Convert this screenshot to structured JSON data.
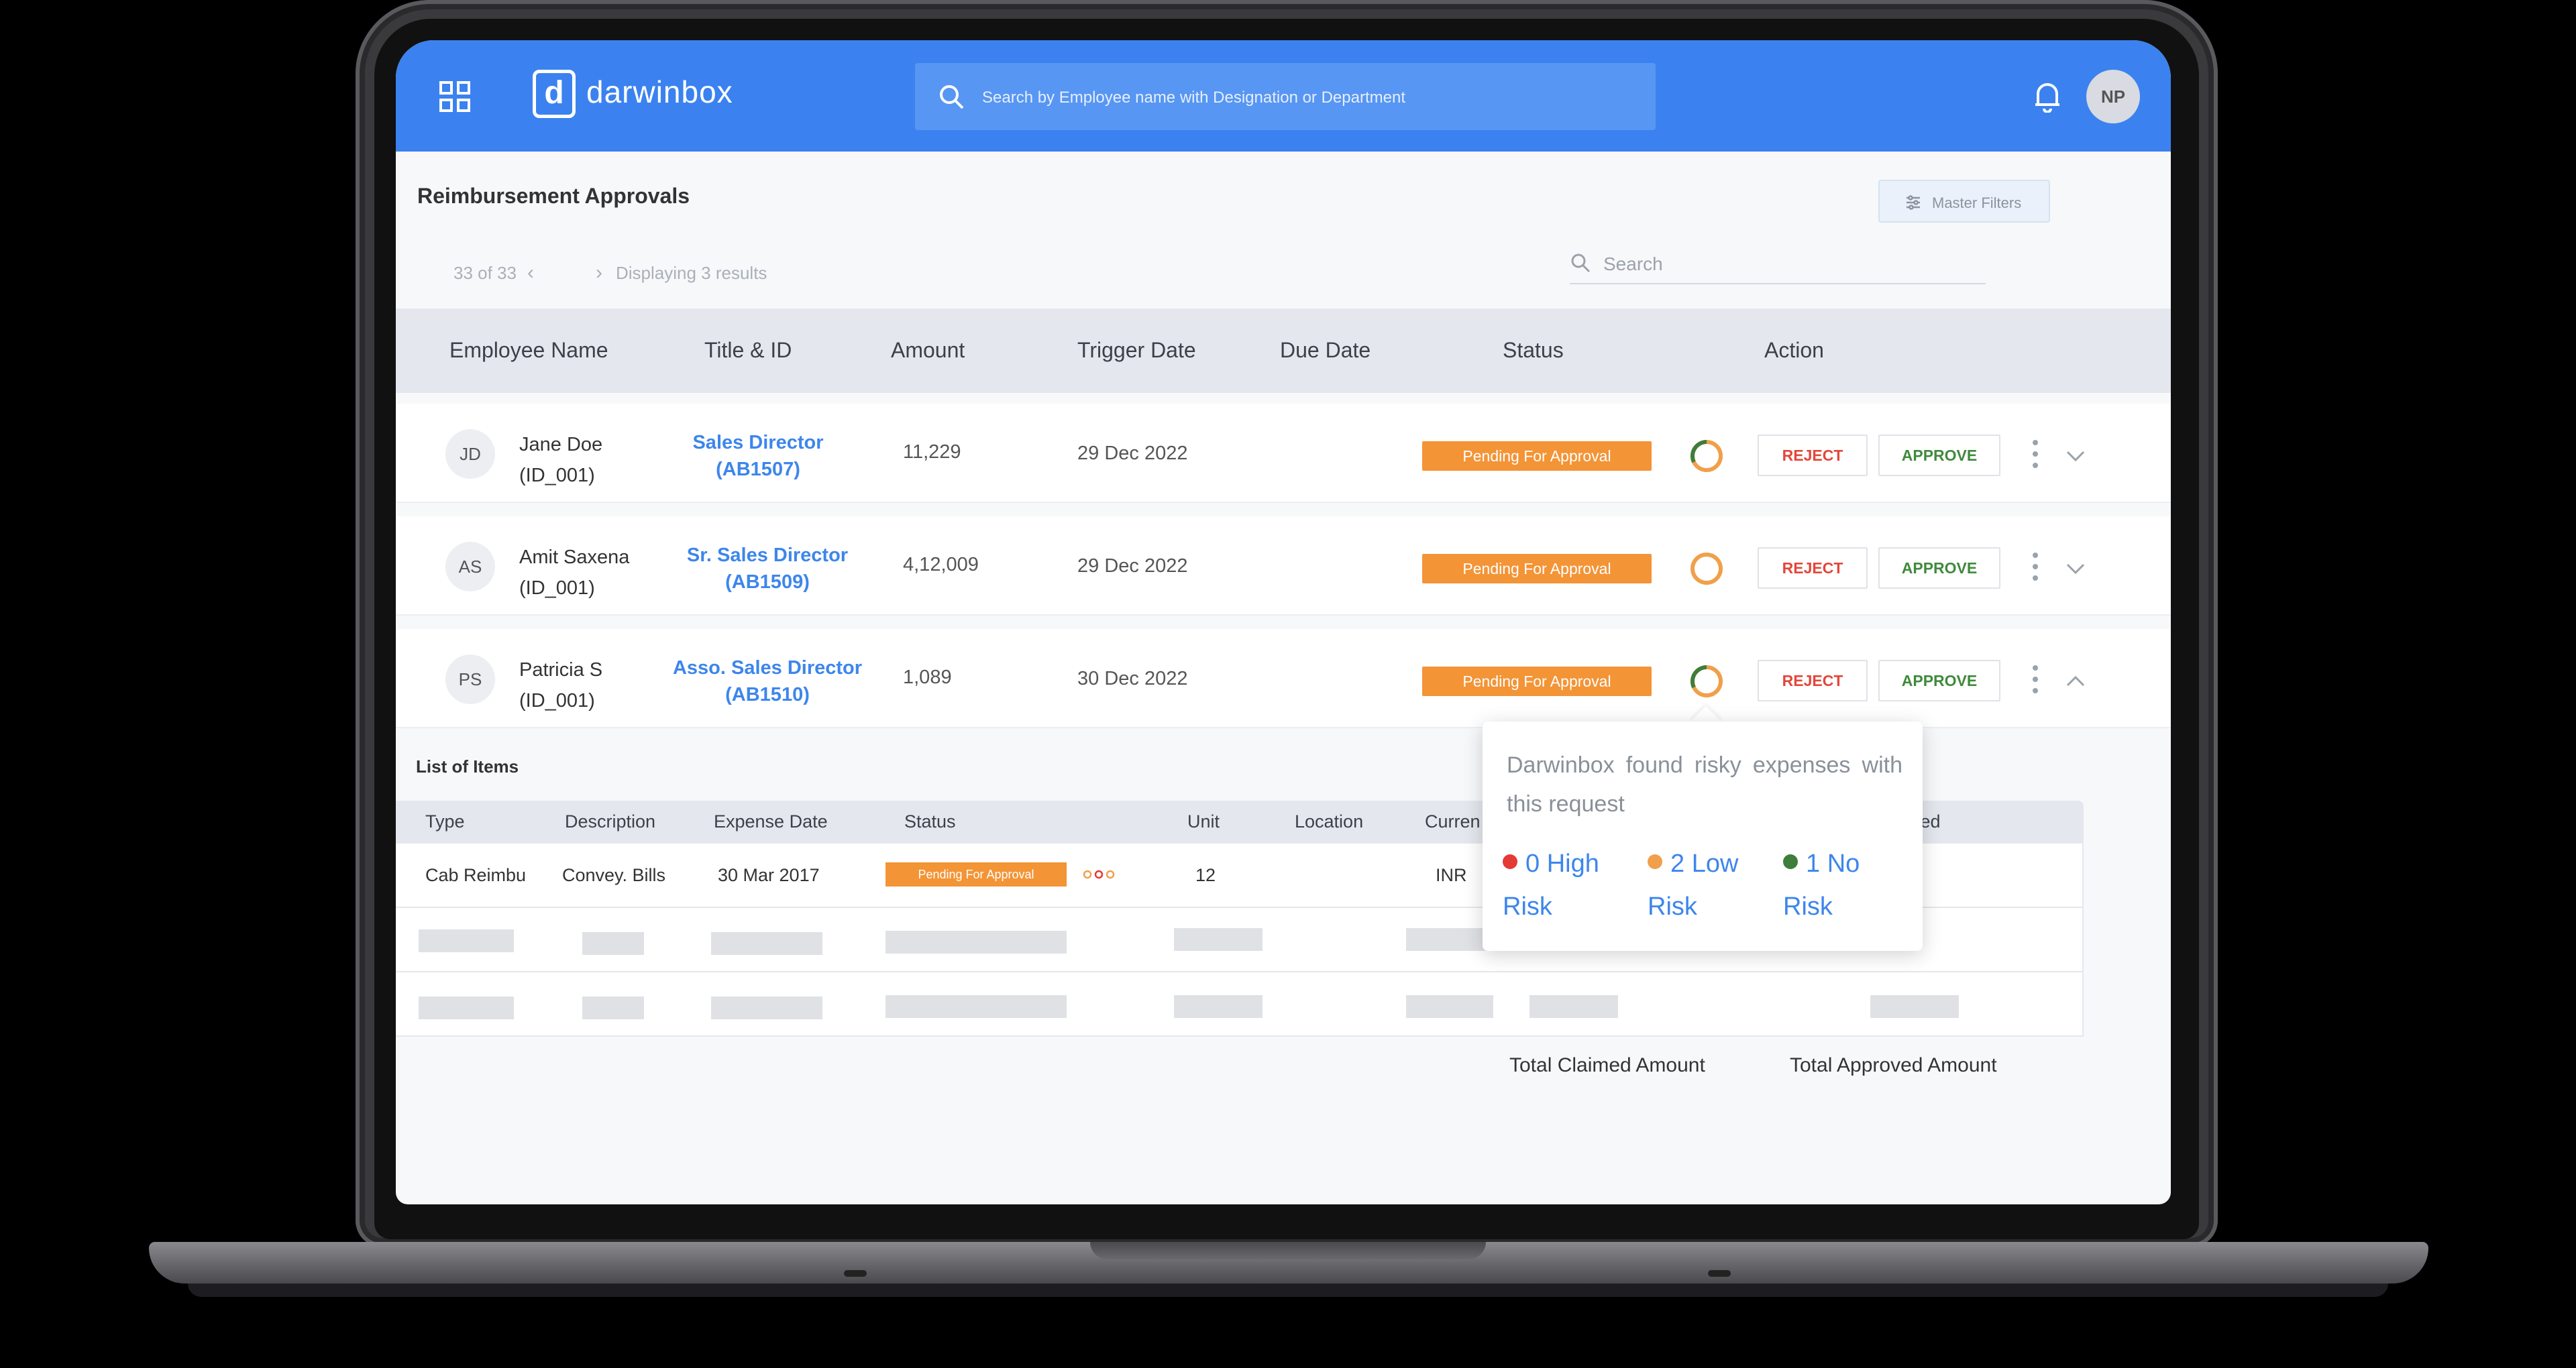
{
  "app": {
    "brand_mark": "d",
    "brand_name": "darwinbox",
    "search_placeholder": "Search by Employee name with Designation or Department",
    "user_initials": "NP"
  },
  "page": {
    "title": "Reimbursement Approvals",
    "master_filters_label": "Master Filters",
    "pager": "33 of 33",
    "pager_info": "Displaying 3 results",
    "search_placeholder": "Search"
  },
  "table": {
    "headers": [
      "Employee Name",
      "Title & ID",
      "Amount",
      "Trigger Date",
      "Due Date",
      "Status",
      "Action"
    ],
    "rows": [
      {
        "initials": "JD",
        "name": "Jane Doe",
        "emp_id": "(ID_001)",
        "title": "Sales Director",
        "title_id": "(AB1507)",
        "amount": "11,229",
        "trigger_date": "29 Dec 2022",
        "status": "Pending For Approval",
        "reject": "REJECT",
        "approve": "APPROVE"
      },
      {
        "initials": "AS",
        "name": "Amit Saxena",
        "emp_id": "(ID_001)",
        "title": "Sr. Sales Director",
        "title_id": "(AB1509)",
        "amount": "4,12,009",
        "trigger_date": "29 Dec 2022",
        "status": "Pending For Approval",
        "reject": "REJECT",
        "approve": "APPROVE"
      },
      {
        "initials": "PS",
        "name": "Patricia S",
        "emp_id": "(ID_001)",
        "title": "Asso. Sales Director",
        "title_id": "(AB1510)",
        "amount": "1,089",
        "trigger_date": "30 Dec 2022",
        "status": "Pending For Approval",
        "reject": "REJECT",
        "approve": "APPROVE"
      }
    ]
  },
  "items": {
    "title": "List of Items",
    "headers": [
      "Type",
      "Description",
      "Expense Date",
      "Status",
      "Unit",
      "Location",
      "Curren",
      "oved"
    ],
    "row": {
      "type": "Cab  Reimbu",
      "description": "Convey. Bills",
      "expense_date": "30 Mar 2017",
      "status": "Pending For Approval",
      "unit": "12",
      "currency": "INR"
    },
    "total_claimed": "Total Claimed Amount",
    "total_approved": "Total Approved Amount"
  },
  "tooltip": {
    "message": "Darwinbox found risky expenses with this request",
    "high": "0 High Risk",
    "low": "2 Low Risk",
    "no": "1 No Risk"
  },
  "colors": {
    "brand_blue": "#3b82f0",
    "pending_orange": "#f39436",
    "reject_red": "#e2473a",
    "approve_green": "#3f8a3c",
    "risk_high": "#e53935",
    "risk_low": "#f0a04b",
    "risk_no": "#3f7d3a"
  },
  "icons": [
    "grid-icon",
    "search-icon",
    "bell-icon",
    "filter-icon",
    "chevron-left-icon",
    "chevron-right-icon",
    "risk-ring-icon",
    "kebab-icon",
    "chevron-down-icon",
    "chevron-up-icon"
  ]
}
